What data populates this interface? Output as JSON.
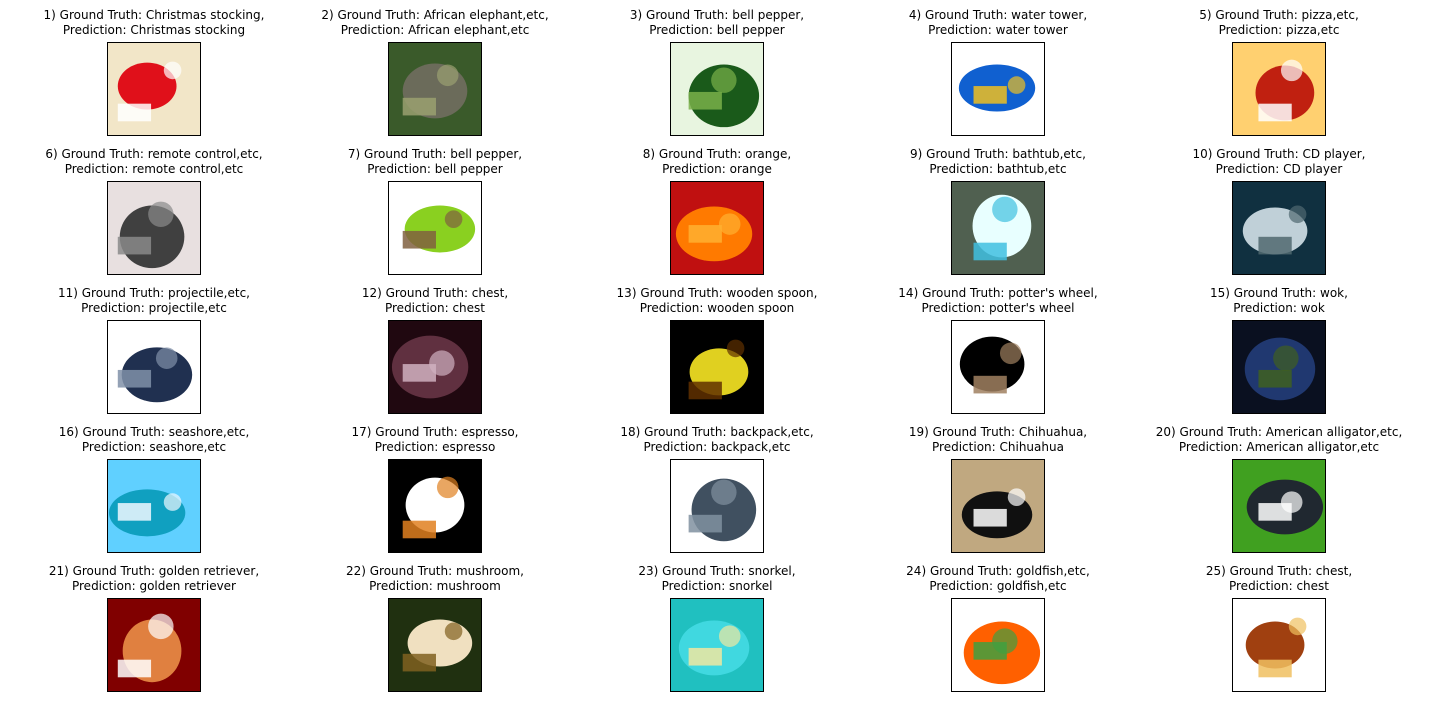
{
  "panels": [
    {
      "gt": "1) Ground Truth: Christmas stocking,",
      "pred": "Prediction: Christmas stocking",
      "icon": "christmas-stocking-image",
      "colors": [
        "#f2e6c8",
        "#e0101a",
        "#ffffff"
      ]
    },
    {
      "gt": "2) Ground Truth: African elephant,etc,",
      "pred": "Prediction: African elephant,etc",
      "icon": "elephant-image",
      "colors": [
        "#3a5a2a",
        "#6b6b5a",
        "#9aa070"
      ]
    },
    {
      "gt": "3) Ground Truth: bell pepper,",
      "pred": "Prediction: bell pepper",
      "icon": "bell-pepper-image",
      "colors": [
        "#e8f5e0",
        "#1a5a1a",
        "#7ab04a"
      ]
    },
    {
      "gt": "4) Ground Truth: water tower,",
      "pred": "Prediction: water tower",
      "icon": "water-tower-image",
      "colors": [
        "#ffffff",
        "#1060d0",
        "#f0c020"
      ]
    },
    {
      "gt": "5) Ground Truth: pizza,etc,",
      "pred": "Prediction: pizza,etc",
      "icon": "pizza-image",
      "colors": [
        "#ffd070",
        "#c02010",
        "#ffffff"
      ]
    },
    {
      "gt": "6) Ground Truth: remote control,etc,",
      "pred": "Prediction: remote control,etc",
      "icon": "remote-control-image",
      "colors": [
        "#e8e0e0",
        "#404040",
        "#8a8a8a"
      ]
    },
    {
      "gt": "7) Ground Truth: bell pepper,",
      "pred": "Prediction: bell pepper",
      "icon": "bell-pepper-image",
      "colors": [
        "#ffffff",
        "#8ad020",
        "#806040"
      ]
    },
    {
      "gt": "8) Ground Truth: orange,",
      "pred": "Prediction: orange",
      "icon": "orange-image",
      "colors": [
        "#c01010",
        "#ff7a00",
        "#ffb030"
      ]
    },
    {
      "gt": "9) Ground Truth: bathtub,etc,",
      "pred": "Prediction: bathtub,etc",
      "icon": "bathtub-image",
      "colors": [
        "#506050",
        "#e8ffff",
        "#40c0e0"
      ]
    },
    {
      "gt": "10) Ground Truth: CD player,",
      "pred": "Prediction: CD player",
      "icon": "cd-player-image",
      "colors": [
        "#103040",
        "#c0d0d8",
        "#506870"
      ]
    },
    {
      "gt": "11) Ground Truth: projectile,etc,",
      "pred": "Prediction: projectile,etc",
      "icon": "projectile-image",
      "colors": [
        "#ffffff",
        "#203050",
        "#8090a8"
      ]
    },
    {
      "gt": "12) Ground Truth: chest,",
      "pred": "Prediction: chest",
      "icon": "chest-image",
      "colors": [
        "#200810",
        "#603040",
        "#d0b0c0"
      ]
    },
    {
      "gt": "13) Ground Truth: wooden spoon,",
      "pred": "Prediction: wooden spoon",
      "icon": "wooden-spoon-image",
      "colors": [
        "#000000",
        "#e0d020",
        "#603000"
      ]
    },
    {
      "gt": "14) Ground Truth: potter's wheel,",
      "pred": "Prediction: potter's wheel",
      "icon": "potters-wheel-image",
      "colors": [
        "#ffffff",
        "#000000",
        "#a08060"
      ]
    },
    {
      "gt": "15) Ground Truth: wok,",
      "pred": "Prediction: wok",
      "icon": "wok-image",
      "colors": [
        "#0a1020",
        "#203870",
        "#406020"
      ]
    },
    {
      "gt": "16) Ground Truth: seashore,etc,",
      "pred": "Prediction: seashore,etc",
      "icon": "seashore-image",
      "colors": [
        "#60d0ff",
        "#10a0c0",
        "#f0f8ff"
      ]
    },
    {
      "gt": "17) Ground Truth: espresso,",
      "pred": "Prediction: espresso",
      "icon": "espresso-image",
      "colors": [
        "#000000",
        "#ffffff",
        "#e08020"
      ]
    },
    {
      "gt": "18) Ground Truth: backpack,etc,",
      "pred": "Prediction: backpack,etc",
      "icon": "backpack-image",
      "colors": [
        "#ffffff",
        "#405060",
        "#8090a0"
      ]
    },
    {
      "gt": "19) Ground Truth: Chihuahua,",
      "pred": "Prediction: Chihuahua",
      "icon": "chihuahua-image",
      "colors": [
        "#c0a880",
        "#101010",
        "#ffffff"
      ]
    },
    {
      "gt": "20) Ground Truth: American alligator,etc,",
      "pred": "Prediction: American alligator,etc",
      "icon": "alligator-image",
      "colors": [
        "#40a020",
        "#202830",
        "#ffffff"
      ]
    },
    {
      "gt": "21) Ground Truth: golden retriever,",
      "pred": "Prediction: golden retriever",
      "icon": "golden-retriever-image",
      "colors": [
        "#800000",
        "#e08040",
        "#ffffff"
      ]
    },
    {
      "gt": "22) Ground Truth: mushroom,",
      "pred": "Prediction: mushroom",
      "icon": "mushroom-image",
      "colors": [
        "#203010",
        "#f0e0c0",
        "#806020"
      ]
    },
    {
      "gt": "23) Ground Truth: snorkel,",
      "pred": "Prediction: snorkel",
      "icon": "snorkel-image",
      "colors": [
        "#20c0c0",
        "#40d8e0",
        "#f0e8a0"
      ]
    },
    {
      "gt": "24) Ground Truth: goldfish,etc,",
      "pred": "Prediction: goldfish,etc",
      "icon": "goldfish-image",
      "colors": [
        "#ffffff",
        "#ff6000",
        "#40a040"
      ]
    },
    {
      "gt": "25) Ground Truth: chest,",
      "pred": "Prediction: chest",
      "icon": "chest-image",
      "colors": [
        "#ffffff",
        "#a04010",
        "#f0c060"
      ]
    }
  ]
}
